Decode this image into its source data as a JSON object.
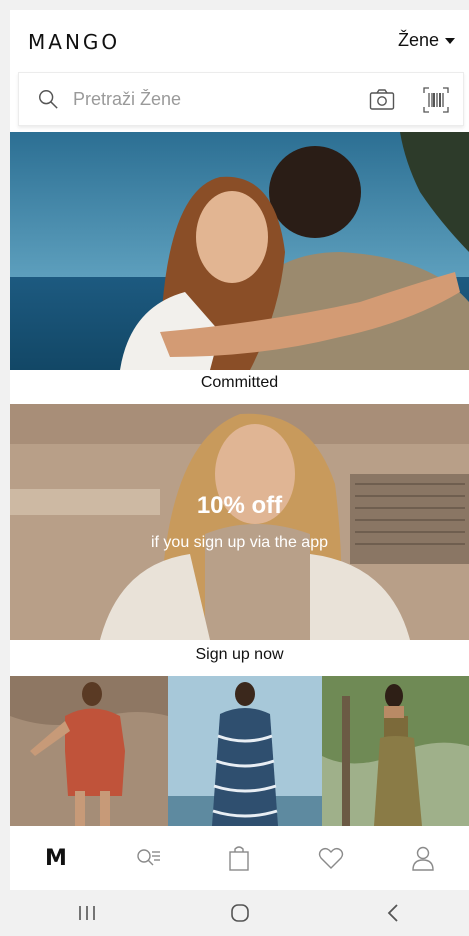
{
  "header": {
    "logo": "MANGO",
    "section_label": "Žene"
  },
  "search": {
    "placeholder": "Pretraži Žene"
  },
  "banners": [
    {
      "caption": "Committed"
    },
    {
      "caption": "Sign up now",
      "promo_title": "10% off",
      "promo_subtitle": "if you sign up via the app"
    }
  ],
  "bottom_nav": {
    "home_label": "M",
    "items": [
      "home",
      "search-list",
      "bag",
      "wishlist",
      "account"
    ]
  },
  "icons": {
    "search": "search-icon",
    "camera": "camera-icon",
    "barcode": "barcode-icon",
    "section_caret": "caret-down-icon",
    "nav_search": "search-list-icon",
    "nav_bag": "shopping-bag-icon",
    "nav_wishlist": "heart-icon",
    "nav_account": "user-icon",
    "sys_recents": "recents-icon",
    "sys_home": "home-icon",
    "sys_back": "back-icon"
  },
  "colors": {
    "text": "#111111",
    "icon_gray": "#8a8a8a",
    "background": "#f1f1f1"
  }
}
